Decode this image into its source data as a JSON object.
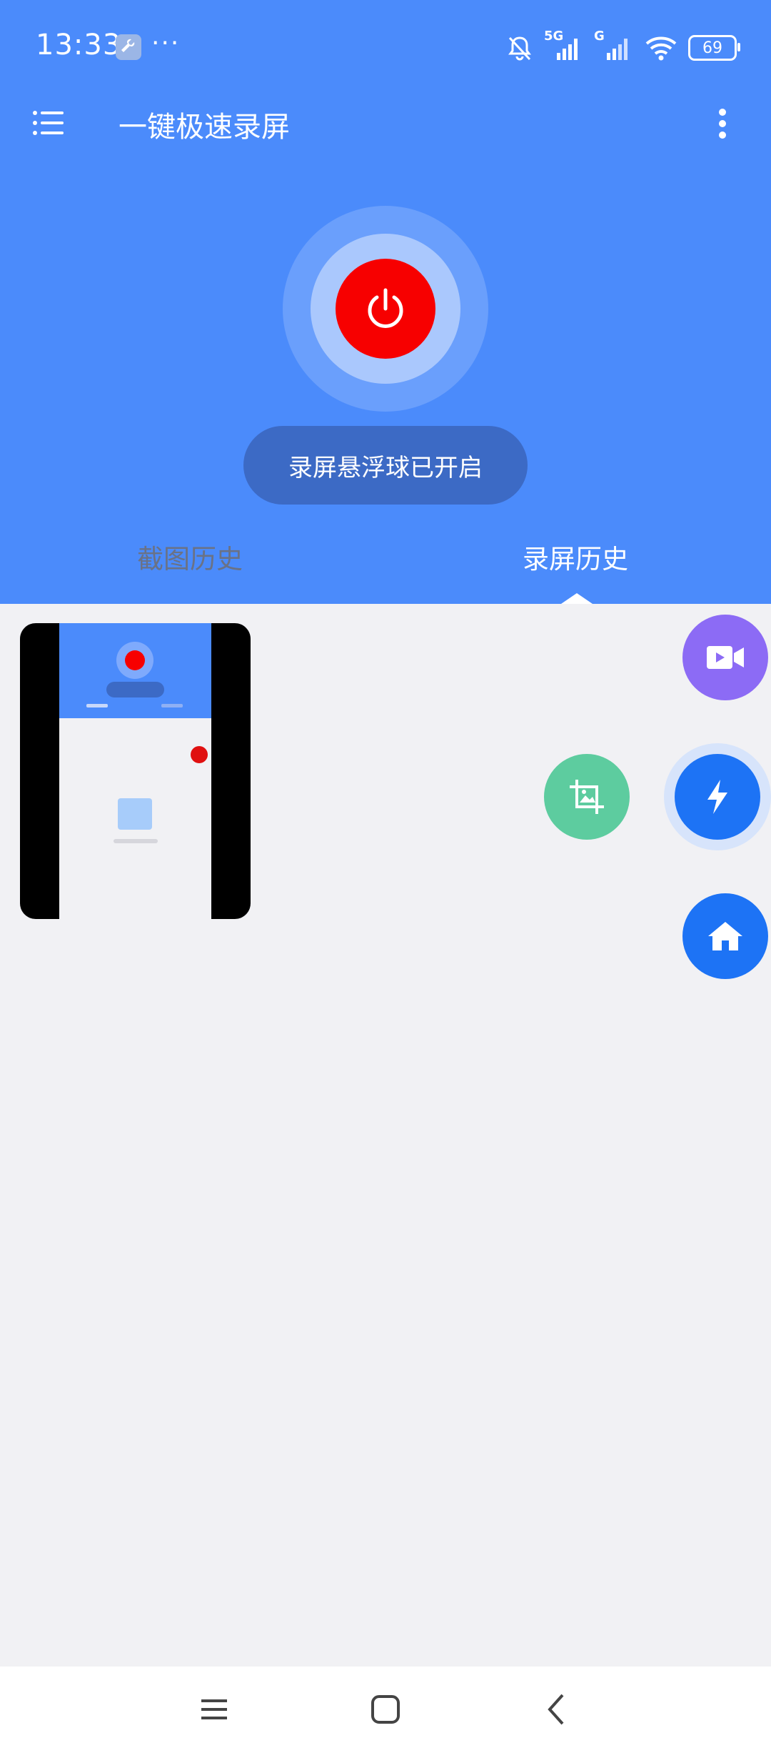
{
  "status_bar": {
    "time": "13:33",
    "overflow_dots": "···",
    "signal_1_tag": "5G",
    "signal_2_tag": "G",
    "battery": "69"
  },
  "toolbar": {
    "title": "一键极速录屏",
    "menu_icon": "menu-icon",
    "more_icon": "more-vertical-icon"
  },
  "power": {
    "status_text": "录屏悬浮球已开启",
    "icon": "power-icon"
  },
  "tabs": [
    {
      "label": "截图历史",
      "selected": false
    },
    {
      "label": "录屏历史",
      "selected": true
    }
  ],
  "fabs": [
    {
      "icon": "video-camera-icon",
      "color": "#8c6bf5"
    },
    {
      "icon": "crop-image-icon",
      "color": "#5dcc9f"
    },
    {
      "icon": "lightning-icon",
      "color": "#1d73f5"
    },
    {
      "icon": "home-icon",
      "color": "#1d73f5"
    }
  ],
  "navbar": {
    "buttons": [
      "menu-nav-icon",
      "home-nav-icon",
      "back-nav-icon"
    ]
  },
  "colors": {
    "header": "#4b8bfb",
    "record_button": "#f70000",
    "background": "#f1f1f4"
  }
}
